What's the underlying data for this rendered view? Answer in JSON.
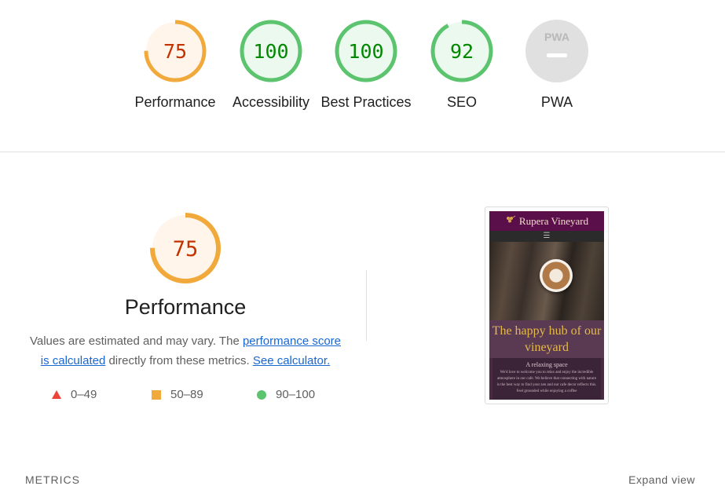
{
  "scores": [
    {
      "label": "Performance",
      "value": "75",
      "fraction": 0.75,
      "status": "average"
    },
    {
      "label": "Accessibility",
      "value": "100",
      "fraction": 1.0,
      "status": "pass"
    },
    {
      "label": "Best Practices",
      "value": "100",
      "fraction": 1.0,
      "status": "pass"
    },
    {
      "label": "SEO",
      "value": "92",
      "fraction": 0.92,
      "status": "pass"
    },
    {
      "label": "PWA",
      "value": "",
      "badge_text": "PWA",
      "status": "na"
    }
  ],
  "colors": {
    "average": "#f2a93b",
    "average_text": "#c33300",
    "average_bg": "#fff5eb",
    "pass": "#5cc46e",
    "pass_text": "#008800",
    "pass_bg": "#ecf9ee",
    "fail": "#eb4335",
    "na_bg": "#e0e0e0",
    "link": "#1967d2"
  },
  "performance": {
    "score": "75",
    "fraction": 0.75,
    "title": "Performance",
    "desc_prefix": "Values are estimated and may vary. The ",
    "desc_link1": "performance score is calculated",
    "desc_middle": " directly from these metrics. ",
    "desc_link2": "See calculator."
  },
  "legend": [
    {
      "shape": "triangle",
      "label": "0–49"
    },
    {
      "shape": "square",
      "label": "50–89"
    },
    {
      "shape": "circle",
      "label": "90–100"
    }
  ],
  "screenshot": {
    "site_name": "Rupera Vineyard",
    "nav_icon": "hamburger-icon",
    "nav_glyph": "☰",
    "tagline": "The happy hub of our vineyard",
    "section_heading": "A relaxing space",
    "section_text": "We'd love to welcome you to relax and enjoy the incredible atmosphere in our cafe. We believe that connecting with nature is the best way to find your zen and our cafe decor reflects this. Feel grounded while enjoying a coffee"
  },
  "metrics": {
    "heading": "METRICS",
    "expand_label": "Expand view"
  }
}
